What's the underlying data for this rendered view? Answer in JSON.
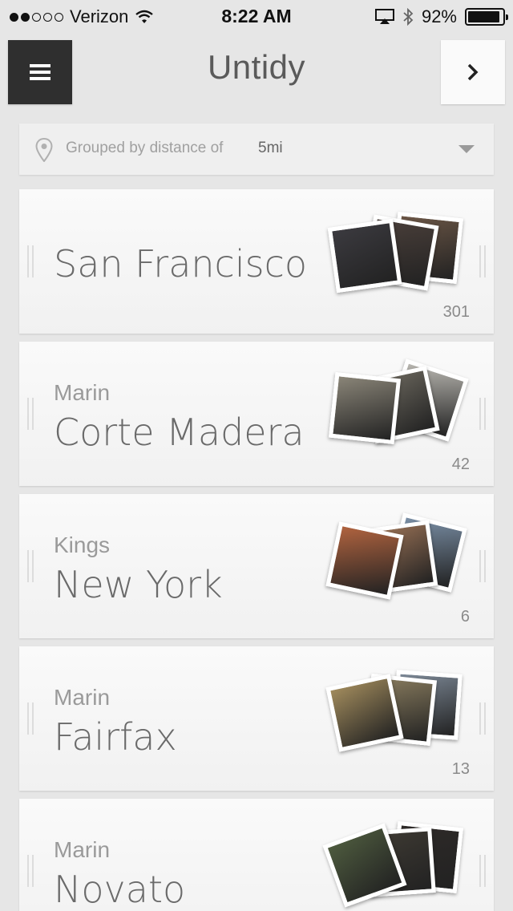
{
  "status_bar": {
    "carrier": "Verizon",
    "time": "8:22 AM",
    "battery": "92%",
    "battery_level": 0.92,
    "signal_bars": 2
  },
  "header": {
    "title": "Untidy",
    "menu_icon": "hamburger-icon",
    "next_icon": "chevron-right-icon"
  },
  "filter": {
    "label": "Grouped by distance of",
    "value": "5mi",
    "icon": "location-pin-icon"
  },
  "groups": [
    {
      "region": "",
      "city": "San Francisco",
      "count": "301",
      "photos": [
        "#3b3a3f",
        "#4a3f3a",
        "#6b5646"
      ]
    },
    {
      "region": "Marin",
      "city": "Corte Madera",
      "count": "42",
      "photos": [
        "#8a8578",
        "#6e6a60",
        "#b8b6b0"
      ]
    },
    {
      "region": "Kings",
      "city": "New York",
      "count": "6",
      "photos": [
        "#b0633f",
        "#9a7256",
        "#7a8fa6"
      ]
    },
    {
      "region": "Marin",
      "city": "Fairfax",
      "count": "13",
      "photos": [
        "#a08a5c",
        "#8a7d5f",
        "#7e8a98"
      ]
    },
    {
      "region": "Marin",
      "city": "Novato",
      "count": "",
      "photos": [
        "#4d5a3e",
        "#3e3a33",
        "#2e2a28"
      ]
    }
  ]
}
